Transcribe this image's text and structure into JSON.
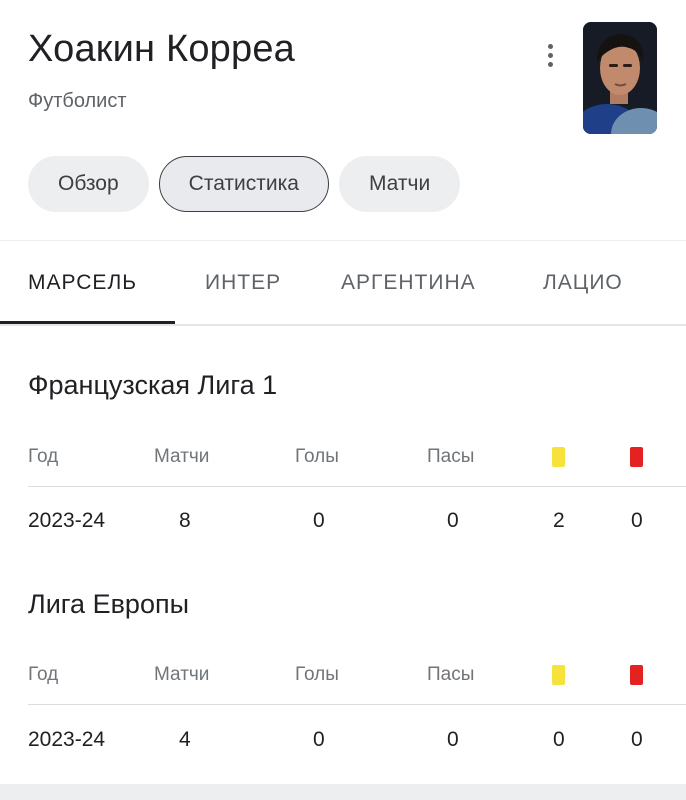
{
  "header": {
    "name": "Хоакин Корреа",
    "role": "Футболист"
  },
  "chips": [
    {
      "label": "Обзор",
      "active": false
    },
    {
      "label": "Статистика",
      "active": true
    },
    {
      "label": "Матчи",
      "active": false
    }
  ],
  "team_tabs": [
    {
      "label": "МАРСЕЛЬ",
      "active": true
    },
    {
      "label": "ИНТЕР",
      "active": false
    },
    {
      "label": "АРГЕНТИНА",
      "active": false
    },
    {
      "label": "ЛАЦИО",
      "active": false
    }
  ],
  "columns": {
    "year": "Год",
    "matches": "Матчи",
    "goals": "Голы",
    "assists": "Пасы",
    "yellow_card_icon": "yellow-card-icon",
    "red_card_icon": "red-card-icon"
  },
  "competitions": [
    {
      "title": "Французская Лига 1",
      "rows": [
        {
          "year": "2023-24",
          "matches": "8",
          "goals": "0",
          "assists": "0",
          "yellow": "2",
          "red": "0"
        }
      ]
    },
    {
      "title": "Лига Европы",
      "rows": [
        {
          "year": "2023-24",
          "matches": "4",
          "goals": "0",
          "assists": "0",
          "yellow": "0",
          "red": "0"
        }
      ]
    }
  ],
  "colors": {
    "yellow_card": "#f6e23a",
    "red_card": "#e52222",
    "active_tab_underline": "#202124"
  }
}
